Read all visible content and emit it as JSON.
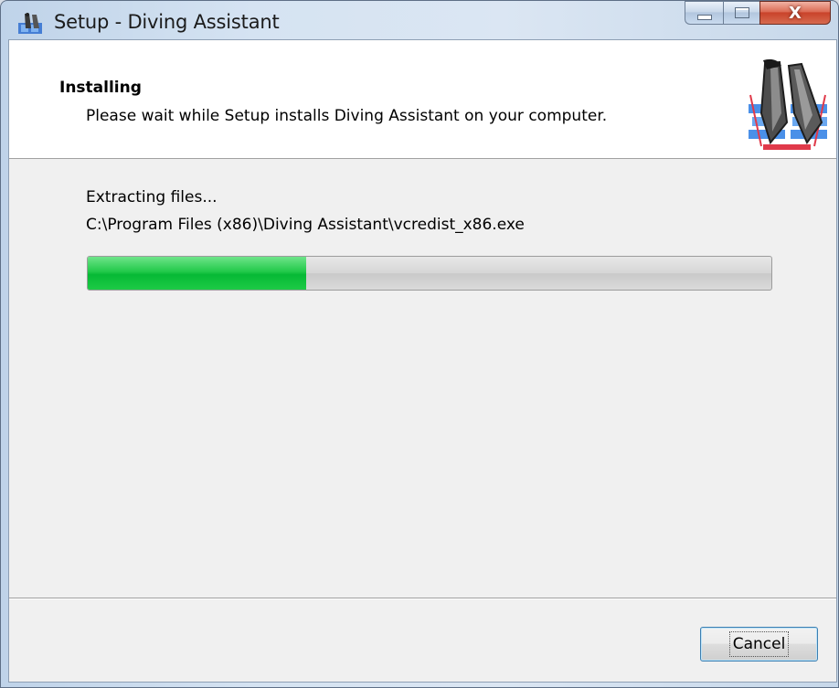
{
  "window": {
    "title": "Setup - Diving Assistant",
    "close_glyph": "X",
    "app_icon": "setup-app-icon",
    "frame_color": "#d5e3f2"
  },
  "header": {
    "title": "Installing",
    "subtitle": "Please wait while Setup installs Diving Assistant on your computer.",
    "image_icon": "diving-fins-icon"
  },
  "status": {
    "action": "Extracting files...",
    "filename": "C:\\Program Files (x86)\\Diving Assistant\\vcredist_x86.exe"
  },
  "progress": {
    "value": 0.32,
    "fill_color": "#06b935"
  },
  "buttons": {
    "cancel_label": "Cancel"
  }
}
